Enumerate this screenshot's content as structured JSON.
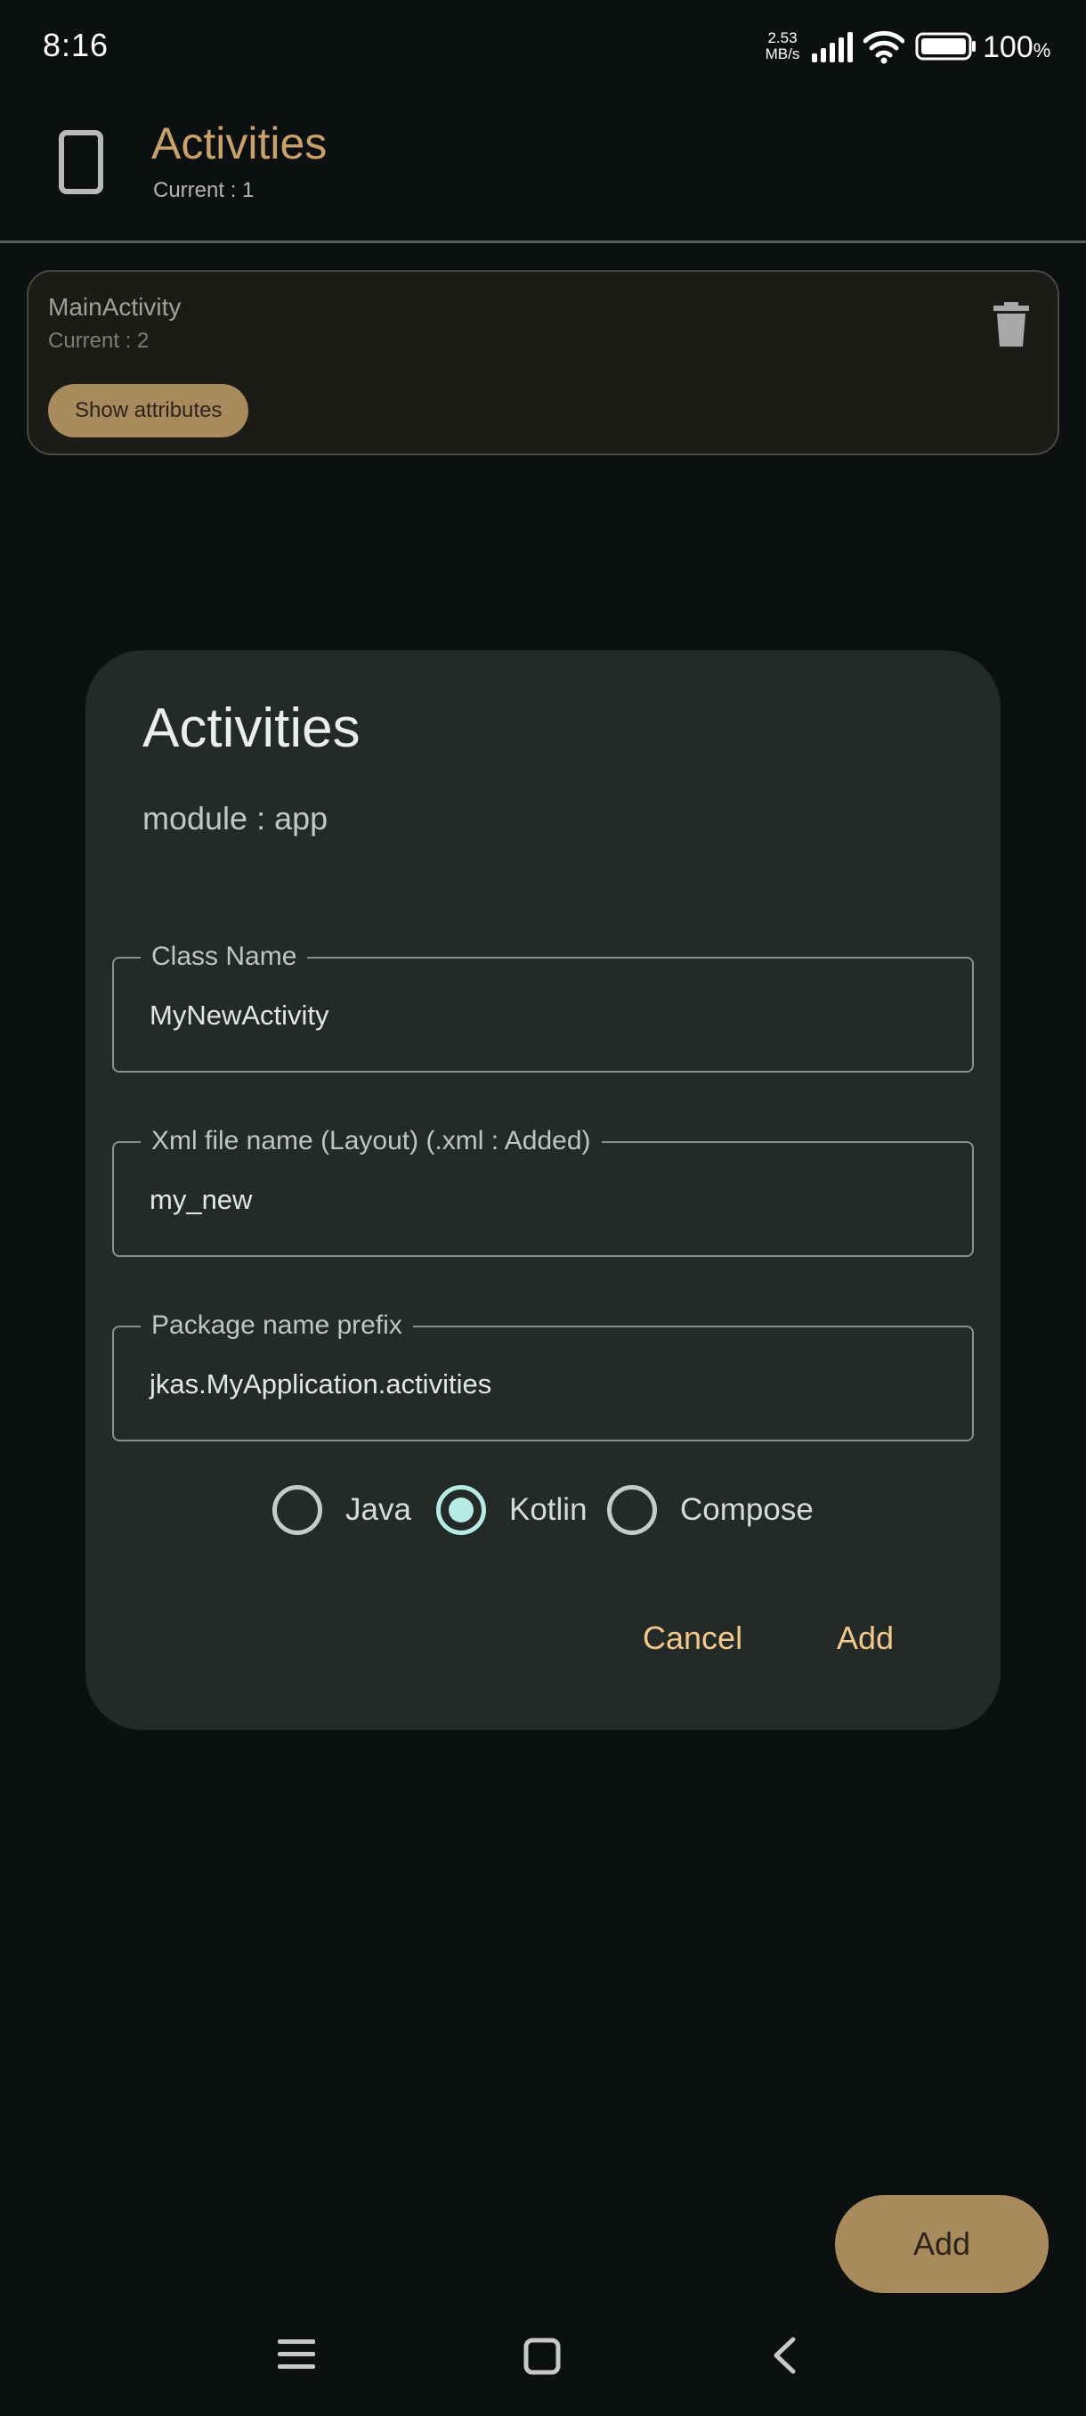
{
  "status_bar": {
    "time": "8:16",
    "net_speed_value": "2.53",
    "net_speed_unit": "MB/s",
    "battery_percent": "100",
    "battery_symbol": "%",
    "icons": [
      "signal-icon",
      "wifi-icon",
      "battery-icon"
    ]
  },
  "app_bar": {
    "icon": "phone-icon",
    "title": "Activities",
    "subtitle": "Current : 1"
  },
  "activity_card": {
    "name": "MainActivity",
    "count": "Current : 2",
    "show_attributes_label": "Show attributes",
    "delete_icon": "trash-icon"
  },
  "dialog": {
    "title": "Activities",
    "module": "module : app",
    "fields": {
      "class_name": {
        "label": "Class Name",
        "value": "MyNewActivity"
      },
      "xml_file": {
        "label": "Xml file name (Layout) (.xml : Added)",
        "value": "my_new"
      },
      "package_prefix": {
        "label": "Package name prefix",
        "value": "jkas.MyApplication.activities"
      }
    },
    "language_options": [
      {
        "label": "Java",
        "selected": false
      },
      {
        "label": "Kotlin",
        "selected": true
      },
      {
        "label": "Compose",
        "selected": false
      }
    ],
    "cancel_label": "Cancel",
    "add_label": "Add"
  },
  "fab": {
    "label": "Add"
  },
  "nav_bar": {
    "icons": [
      "menu-icon",
      "home-icon",
      "back-icon"
    ]
  },
  "colors": {
    "background": "#0d1010",
    "accent": "#c8a06c",
    "button_fill": "#a98a5d",
    "dialog_bg": "#232a28",
    "radio_selected": "#b7ece5",
    "dialog_action": "#f2c98a"
  }
}
